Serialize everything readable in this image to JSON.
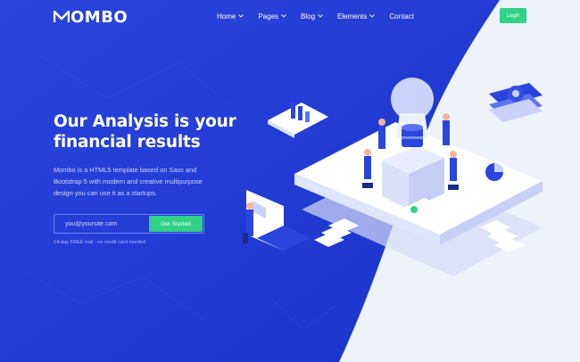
{
  "brand": {
    "logo_text": "OMBO"
  },
  "nav": {
    "items": [
      {
        "label": "Home",
        "has_dropdown": true
      },
      {
        "label": "Pages",
        "has_dropdown": true
      },
      {
        "label": "Blog",
        "has_dropdown": true
      },
      {
        "label": "Elements",
        "has_dropdown": true
      },
      {
        "label": "Contact",
        "has_dropdown": false
      }
    ],
    "login_label": "Login"
  },
  "hero": {
    "title": "Our Analysis is your financial results",
    "description": "Mombo is a HTML5 template based on Sass and Bootstrap 5 with modern and creative multipurpose design you can use it as a startups.",
    "email_placeholder": "you@yoursite.com",
    "cta_label": "Get Started",
    "note": "14-day FREE trial · no credit card needed"
  },
  "colors": {
    "primary": "#1f3bd6",
    "accent_green": "#2fd286",
    "background_light": "#eef2fb"
  },
  "icons": [
    "logo-m-icon",
    "chevron-down-icon"
  ]
}
